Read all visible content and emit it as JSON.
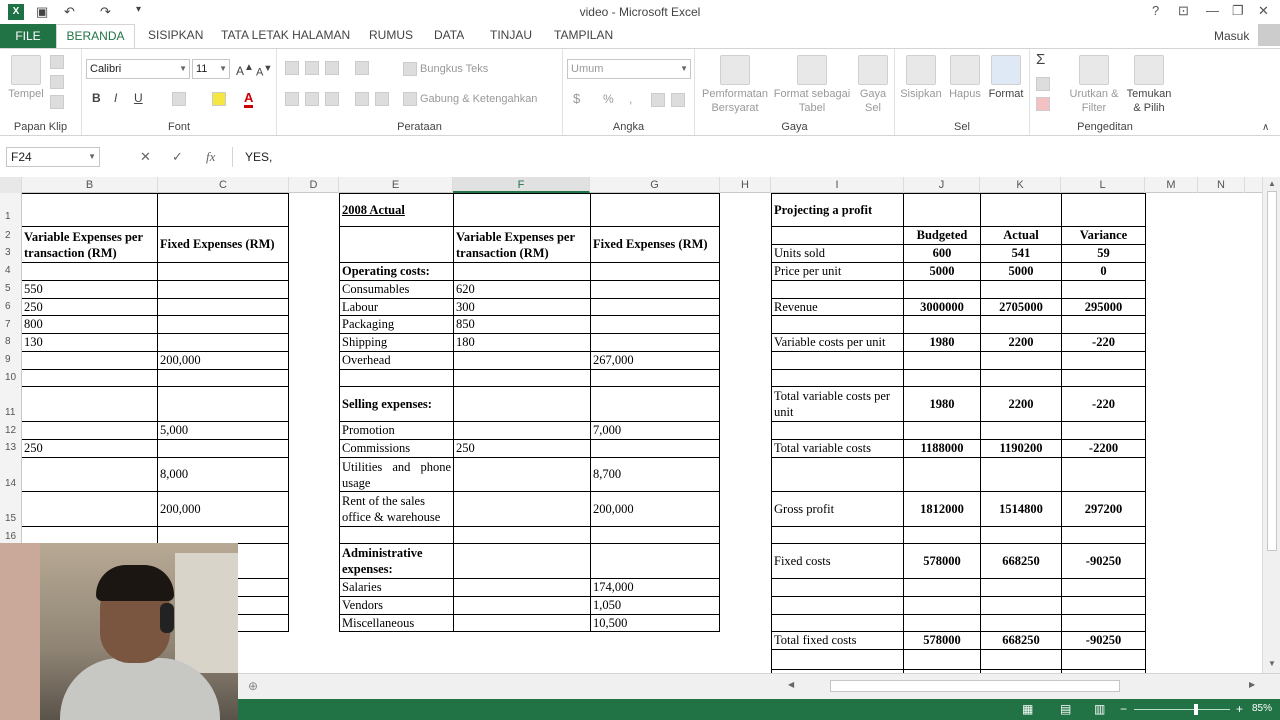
{
  "window": {
    "title": "video - Microsoft Excel",
    "user": "Masuk",
    "help": "?",
    "controls": [
      "⊡",
      "—",
      "❐",
      "✕"
    ]
  },
  "tabs": [
    "FILE",
    "BERANDA",
    "SISIPKAN",
    "TATA LETAK HALAMAN",
    "RUMUS",
    "DATA",
    "TINJAU",
    "TAMPILAN"
  ],
  "ribbon": {
    "clipboard": {
      "paste": "Tempel",
      "label": "Papan Klip"
    },
    "font": {
      "name": "Calibri",
      "size": "11",
      "label": "Font",
      "bold": "B",
      "italic": "I",
      "underline": "U"
    },
    "alignment": {
      "wrap": "Bungkus Teks",
      "merge": "Gabung & Ketengahkan",
      "label": "Perataan"
    },
    "number": {
      "format": "Umum",
      "label": "Angka"
    },
    "styles": {
      "conditional": "Pemformatan Bersyarat",
      "table": "Format sebagai Tabel",
      "cell": "Gaya Sel",
      "label": "Gaya"
    },
    "cells": {
      "insert": "Sisipkan",
      "delete": "Hapus",
      "format": "Format",
      "label": "Sel"
    },
    "editing": {
      "sort": "Urutkan & Filter",
      "find": "Temukan & Pilih",
      "label": "Pengeditan"
    }
  },
  "formula_bar": {
    "name_box": "F24",
    "value": "YES,",
    "fx": "fx"
  },
  "columns": [
    "B",
    "C",
    "D",
    "E",
    "F",
    "G",
    "H",
    "I",
    "J",
    "K",
    "L",
    "M",
    "N"
  ],
  "rows": [
    "1",
    "2",
    "3",
    "4",
    "5",
    "6",
    "7",
    "8",
    "9",
    "10",
    "11",
    "12",
    "13",
    "14",
    "15",
    "16"
  ],
  "cells": {
    "B2": "Variable Expenses per transaction (RM)",
    "C2": "Fixed Expenses (RM)",
    "B5": "550",
    "B6": "250",
    "B7": "800",
    "B8": "130",
    "C9": "200,000",
    "C12": "5,000",
    "B13": "250",
    "C14": "8,000",
    "C15": "200,000",
    "E1": "2008 Actual",
    "F2": "Variable Expenses per transaction (RM)",
    "G2": "Fixed Expenses (RM)",
    "E4": "Operating costs:",
    "E5": "Consumables",
    "F5": "620",
    "E6": "Labour",
    "F6": "300",
    "E7": "Packaging",
    "F7": "850",
    "E8": "Shipping",
    "F8": "180",
    "E9": "Overhead",
    "G9": "267,000",
    "E11": "Selling expenses:",
    "E12": "Promotion",
    "G12": "7,000",
    "E13": "Commissions",
    "F13": "250",
    "E14": "Utilities and phone usage",
    "G14": "8,700",
    "E15": "Rent of the sales office & warehouse",
    "G15": "200,000",
    "E17": "Administrative expenses:",
    "E18": "Salaries",
    "G18": "174,000",
    "E19": "Vendors",
    "G19": "1,050",
    "E20": "Miscellaneous",
    "G20": "10,500",
    "I1": "Projecting a profit",
    "J2": "Budgeted",
    "K2": "Actual",
    "L2": "Variance",
    "I3": "Units sold",
    "J3": "600",
    "K3": "541",
    "L3": "59",
    "I4": "Price per unit",
    "J4": "5000",
    "K4": "5000",
    "L4": "0",
    "I6": "Revenue",
    "J6": "3000000",
    "K6": "2705000",
    "L6": "295000",
    "I8": "Variable costs per unit",
    "J8": "1980",
    "K8": "2200",
    "L8": "-220",
    "I11": "Total variable costs per unit",
    "J11": "1980",
    "K11": "2200",
    "L11": "-220",
    "I13": "Total variable costs",
    "J13": "1188000",
    "K13": "1190200",
    "L13": "-2200",
    "I15": "Gross profit",
    "J15": "1812000",
    "K15": "1514800",
    "L15": "297200",
    "I17": "Fixed costs",
    "J17": "578000",
    "K17": "668250",
    "L17": "-90250",
    "I22": "Total fixed costs",
    "J22": "578000",
    "K22": "668250",
    "L22": "-90250"
  },
  "status": {
    "zoom": "85%"
  }
}
